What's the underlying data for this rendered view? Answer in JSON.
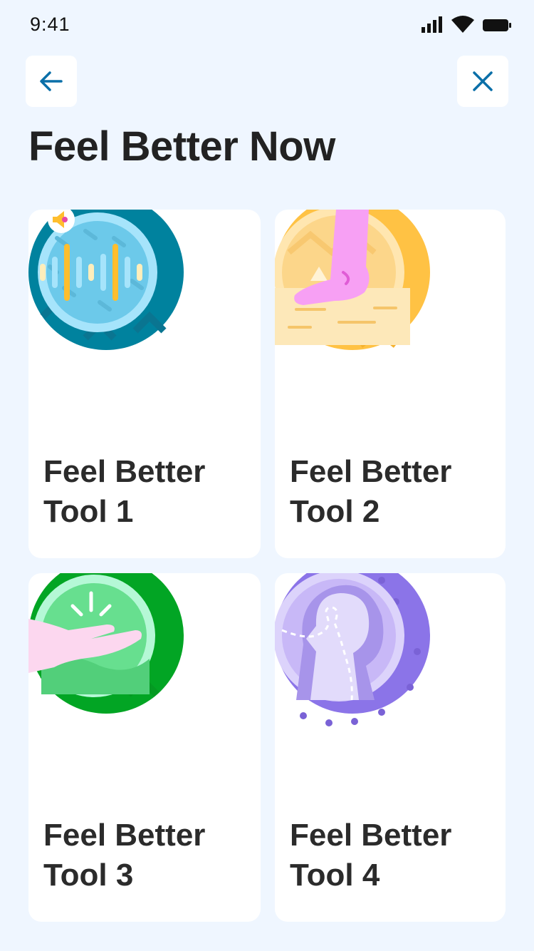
{
  "status_bar": {
    "time": "9:41",
    "icons": [
      "signal-icon",
      "wifi-icon",
      "battery-icon"
    ]
  },
  "header": {
    "back_icon": "arrow-left-icon",
    "close_icon": "close-icon",
    "title": "Feel Better Now"
  },
  "colors": {
    "background": "#eff6ff",
    "card": "#ffffff",
    "accent": "#0a6fa8",
    "tool1": "#00829e",
    "tool2": "#ffc244",
    "tool3": "#02a524",
    "tool4": "#8b74e8"
  },
  "tools": [
    {
      "title": "Feel Better Tool 1",
      "icon": "audio-wave-icon"
    },
    {
      "title": "Feel Better Tool 2",
      "icon": "foot-grounding-icon"
    },
    {
      "title": "Feel Better Tool 3",
      "icon": "open-hand-icon"
    },
    {
      "title": "Feel Better Tool 4",
      "icon": "breathing-head-icon"
    }
  ]
}
